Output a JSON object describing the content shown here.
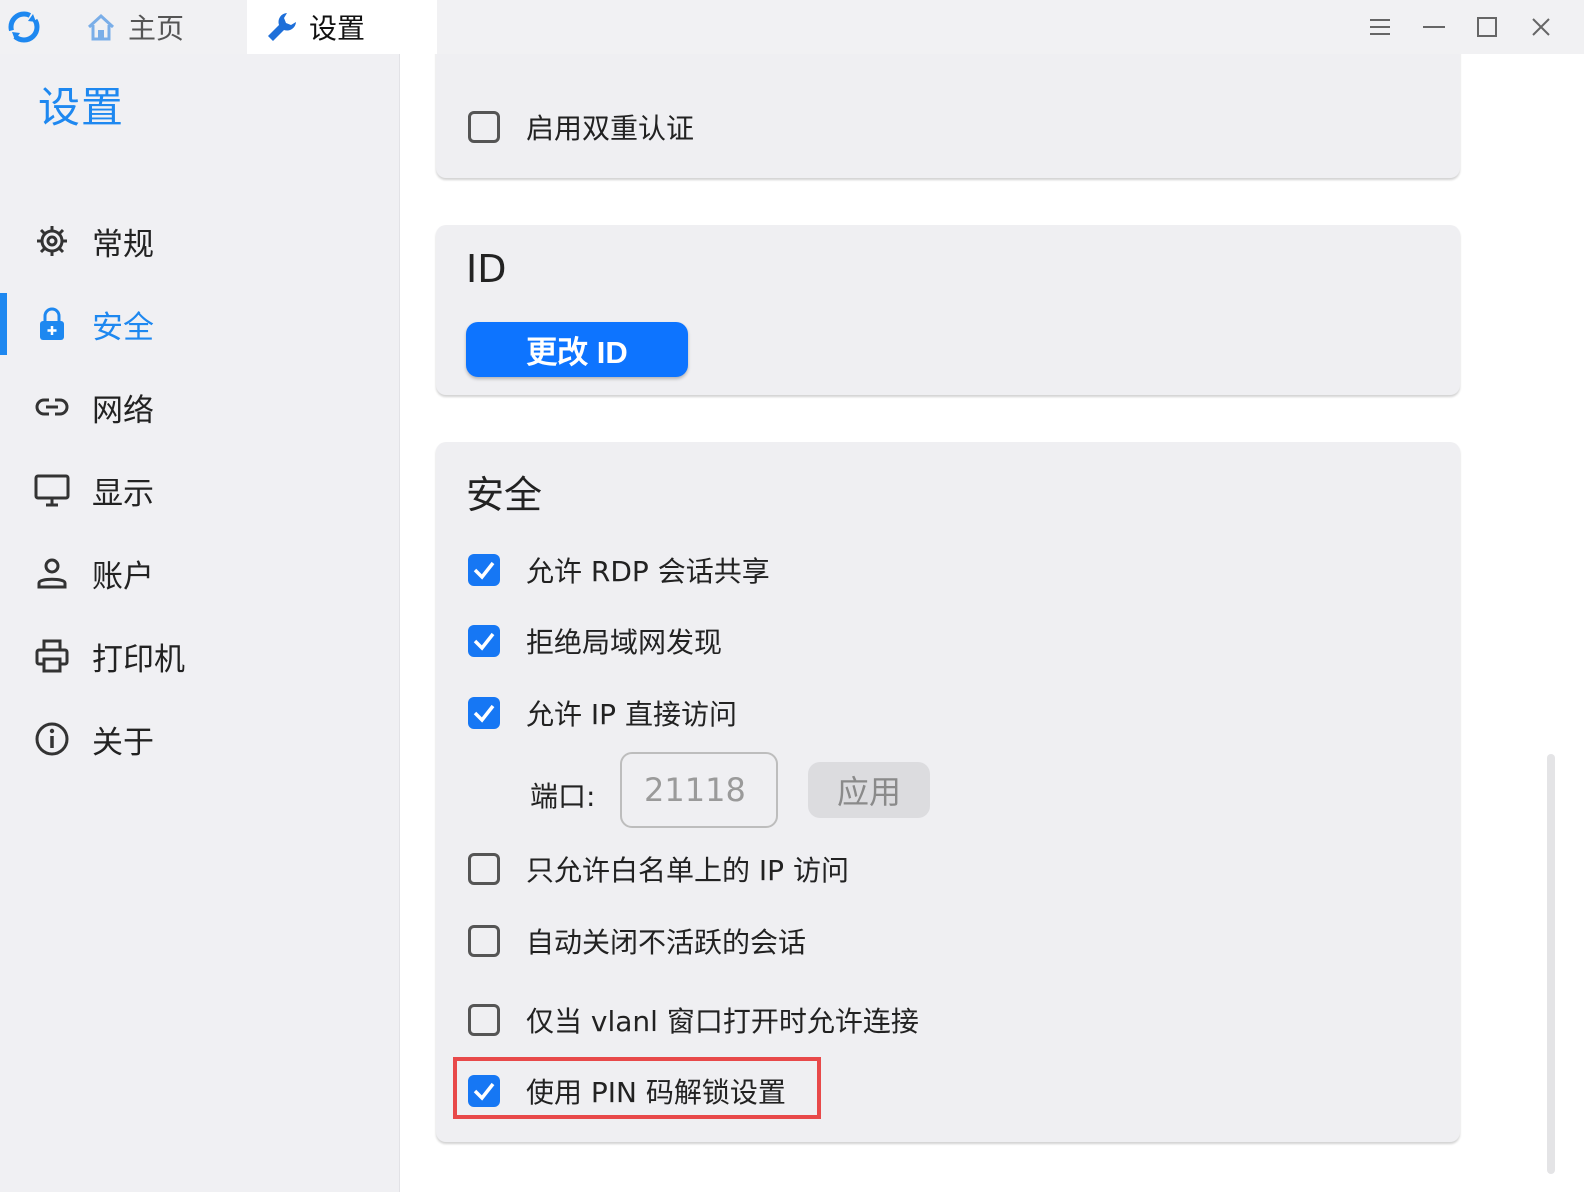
{
  "titlebar": {
    "tabs": [
      {
        "label": "主页",
        "icon": "home-icon"
      },
      {
        "label": "设置",
        "icon": "wrench-icon"
      }
    ],
    "controls": [
      "menu-icon",
      "minimize-icon",
      "maximize-icon",
      "close-icon"
    ]
  },
  "sidebar": {
    "title": "设置",
    "items": [
      {
        "label": "常规",
        "icon": "gear-icon"
      },
      {
        "label": "安全",
        "icon": "lock-icon",
        "active": true
      },
      {
        "label": "网络",
        "icon": "link-icon"
      },
      {
        "label": "显示",
        "icon": "monitor-icon"
      },
      {
        "label": "账户",
        "icon": "person-icon"
      },
      {
        "label": "打印机",
        "icon": "printer-icon"
      },
      {
        "label": "关于",
        "icon": "info-icon"
      }
    ]
  },
  "main": {
    "top_card": {
      "options": [
        {
          "label": "启用双重认证",
          "checked": false
        }
      ]
    },
    "id_card": {
      "title": "ID",
      "button_label": "更改 ID"
    },
    "security_card": {
      "title": "安全",
      "options": [
        {
          "label": "允许 RDP 会话共享",
          "checked": true
        },
        {
          "label": "拒绝局域网发现",
          "checked": true
        },
        {
          "label": "允许 IP 直接访问",
          "checked": true
        },
        {
          "label": "只允许白名单上的 IP 访问",
          "checked": false
        },
        {
          "label": "自动关闭不活跃的会话",
          "checked": false
        },
        {
          "label": "仅当 vlanl 窗口打开时允许连接",
          "checked": false
        },
        {
          "label": "使用 PIN 码解锁设置",
          "checked": true
        }
      ],
      "port": {
        "label": "端口:",
        "placeholder": "21118",
        "apply_label": "应用"
      }
    }
  },
  "colors": {
    "accent": "#1e88f0",
    "primary_button": "#0d74ff",
    "checkbox": "#1677f4",
    "highlight": "#e8494a"
  }
}
